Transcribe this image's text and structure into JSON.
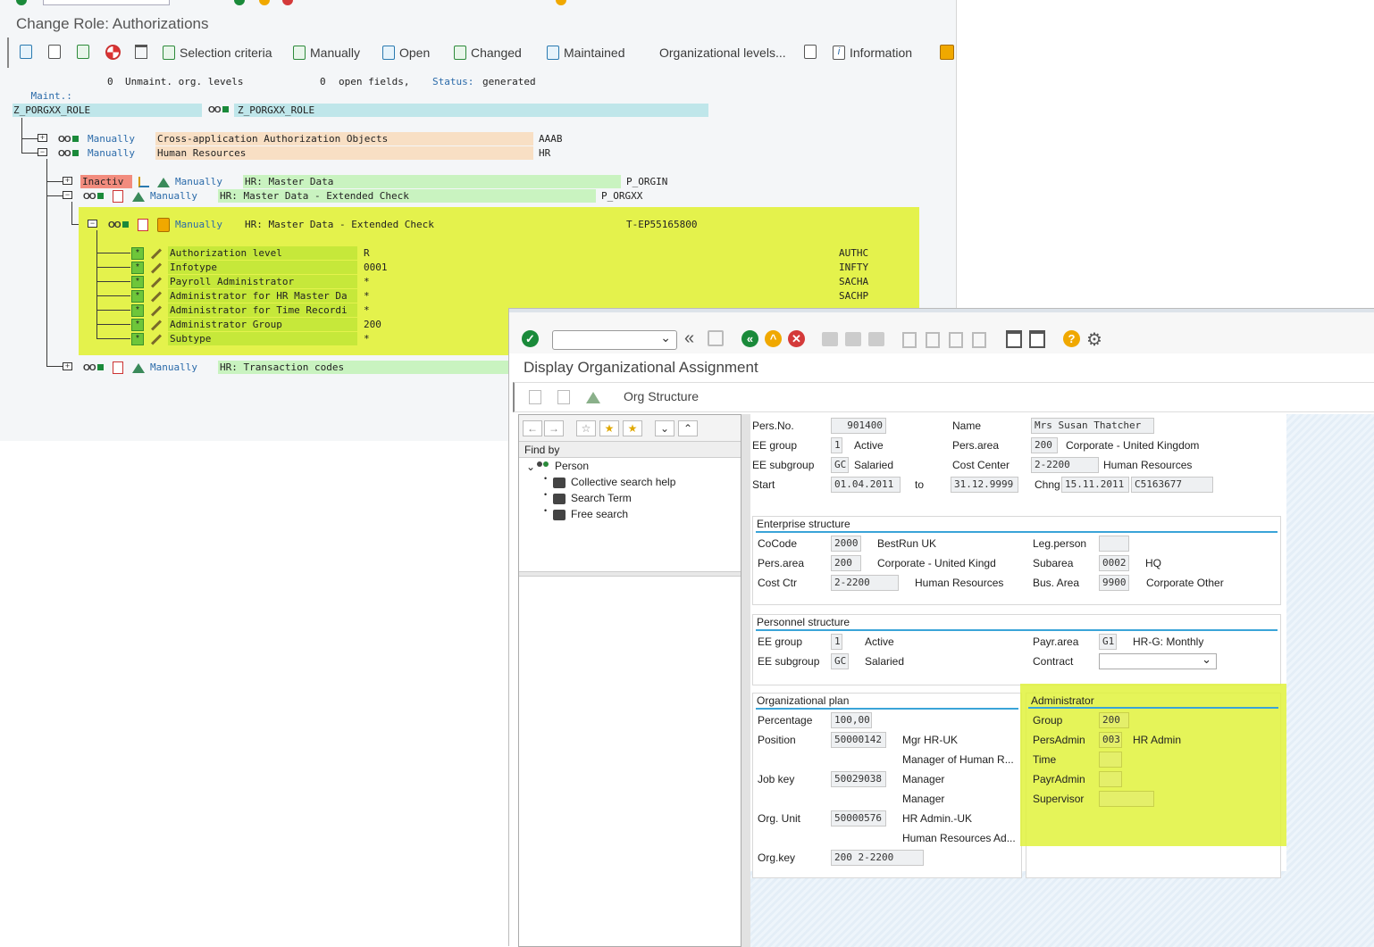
{
  "roleWindow": {
    "title": "Change Role: Authorizations",
    "toolbar": {
      "selection_criteria": "Selection criteria",
      "manually": "Manually",
      "open": "Open",
      "changed": "Changed",
      "maintained": "Maintained",
      "org_levels": "Organizational levels...",
      "information": "Information"
    },
    "status": {
      "maint_label": "Maint.:",
      "maint_value": "0",
      "unmaint_label": "Unmaint. org. levels",
      "open_value": "0",
      "open_label": "open fields,",
      "status_label": "Status:",
      "status_value": "generated"
    },
    "tree": {
      "root": "Z_PORGXX_ROLE",
      "root_text": "Z_PORGXX_ROLE",
      "lvl1": [
        {
          "status": "Manually",
          "text": "Cross-application Authorization Objects",
          "code": "AAAB"
        },
        {
          "status": "Manually",
          "text": "Human Resources",
          "code": "HR"
        }
      ],
      "lvl2": [
        {
          "badge": "Inactiv",
          "status": "Manually",
          "text": "HR: Master Data",
          "code": "P_ORGIN"
        },
        {
          "status": "Manually",
          "text": "HR: Master Data - Extended Check",
          "code": "P_ORGXX"
        }
      ],
      "lvl3": {
        "status": "Manually",
        "text": "HR: Master Data - Extended Check",
        "code": "T-EP55165800"
      },
      "fields": [
        {
          "star": "*",
          "name": "Authorization level",
          "value": "R",
          "code": "AUTHC"
        },
        {
          "star": "*",
          "name": "Infotype",
          "value": "0001",
          "code": "INFTY"
        },
        {
          "star": "*",
          "name": "Payroll Administrator",
          "value": "*",
          "code": "SACHA"
        },
        {
          "star": "*",
          "name": "Administrator for HR Master Da",
          "value": "*",
          "code": "SACHP"
        },
        {
          "star": "*",
          "name": "Administrator for Time Recordi",
          "value": "*",
          "code": ""
        },
        {
          "star": "*",
          "name": "Administrator Group",
          "value": "200",
          "code": ""
        },
        {
          "star": "*",
          "name": "Subtype",
          "value": "*",
          "code": ""
        }
      ],
      "last": {
        "status": "Manually",
        "text": "HR: Transaction codes"
      }
    }
  },
  "orgWindow": {
    "title": "Display Organizational Assignment",
    "app_button": "Org Structure",
    "nav": {
      "find_by": "Find by",
      "person": "Person",
      "items": [
        "Collective search help",
        "Search Term",
        "Free search"
      ]
    },
    "header": {
      "persno_label": "Pers.No.",
      "persno": "901400",
      "name_label": "Name",
      "name": "Mrs Susan Thatcher",
      "eegroup_label": "EE group",
      "eegroup": "1",
      "eegroup_text": "Active",
      "persarea_label": "Pers.area",
      "persarea": "200",
      "persarea_text": "Corporate - United Kingdom",
      "eesub_label": "EE subgroup",
      "eesub": "GC",
      "eesub_text": "Salaried",
      "costcenter_label": "Cost Center",
      "costcenter": "2-2200",
      "costcenter_text": "Human Resources",
      "start_label": "Start",
      "start": "01.04.2011",
      "to_label": "to",
      "end": "31.12.9999",
      "chng_label": "Chng",
      "chng": "15.11.2011",
      "chng_user": "C5163677"
    },
    "enterprise": {
      "title": "Enterprise structure",
      "cocode_label": "CoCode",
      "cocode": "2000",
      "cocode_text": "BestRun UK",
      "legperson_label": "Leg.person",
      "legperson": "",
      "persarea_label": "Pers.area",
      "persarea": "200",
      "persarea_text": "Corporate - United Kingd",
      "subarea_label": "Subarea",
      "subarea": "0002",
      "subarea_text": "HQ",
      "costctr_label": "Cost Ctr",
      "costctr": "2-2200",
      "costctr_text": "Human Resources",
      "busarea_label": "Bus. Area",
      "busarea": "9900",
      "busarea_text": "Corporate Other"
    },
    "personnel": {
      "title": "Personnel structure",
      "eegroup_label": "EE group",
      "eegroup": "1",
      "eegroup_text": "Active",
      "payrarea_label": "Payr.area",
      "payrarea": "G1",
      "payrarea_text": "HR-G: Monthly",
      "eesub_label": "EE subgroup",
      "eesub": "GC",
      "eesub_text": "Salaried",
      "contract_label": "Contract",
      "contract": ""
    },
    "orgplan": {
      "title": "Organizational plan",
      "percentage_label": "Percentage",
      "percentage": "100,00",
      "position_label": "Position",
      "position": "50000142",
      "position_text1": "Mgr HR-UK",
      "position_text2": "Manager of Human R...",
      "jobkey_label": "Job key",
      "jobkey": "50029038",
      "jobkey_text1": "Manager",
      "jobkey_text2": "Manager",
      "orgunit_label": "Org. Unit",
      "orgunit": "50000576",
      "orgunit_text1": "HR Admin.-UK",
      "orgunit_text2": "Human Resources Ad...",
      "orgkey_label": "Org.key",
      "orgkey": "200 2-2200"
    },
    "administrator": {
      "title": "Administrator",
      "group_label": "Group",
      "group": "200",
      "persadmin_label": "PersAdmin",
      "persadmin": "003",
      "persadmin_text": "HR Admin",
      "time_label": "Time",
      "time": "",
      "payradmin_label": "PayrAdmin",
      "payradmin": "",
      "supervisor_label": "Supervisor",
      "supervisor": ""
    }
  },
  "colors": {
    "highlight": "#e4f24c",
    "tree_root": "#bfe6ea",
    "tree_peach": "#f8dfc4",
    "tree_green": "#c9f3c0",
    "inactive": "#f28c7e",
    "accent_line": "#3aa4d8"
  }
}
